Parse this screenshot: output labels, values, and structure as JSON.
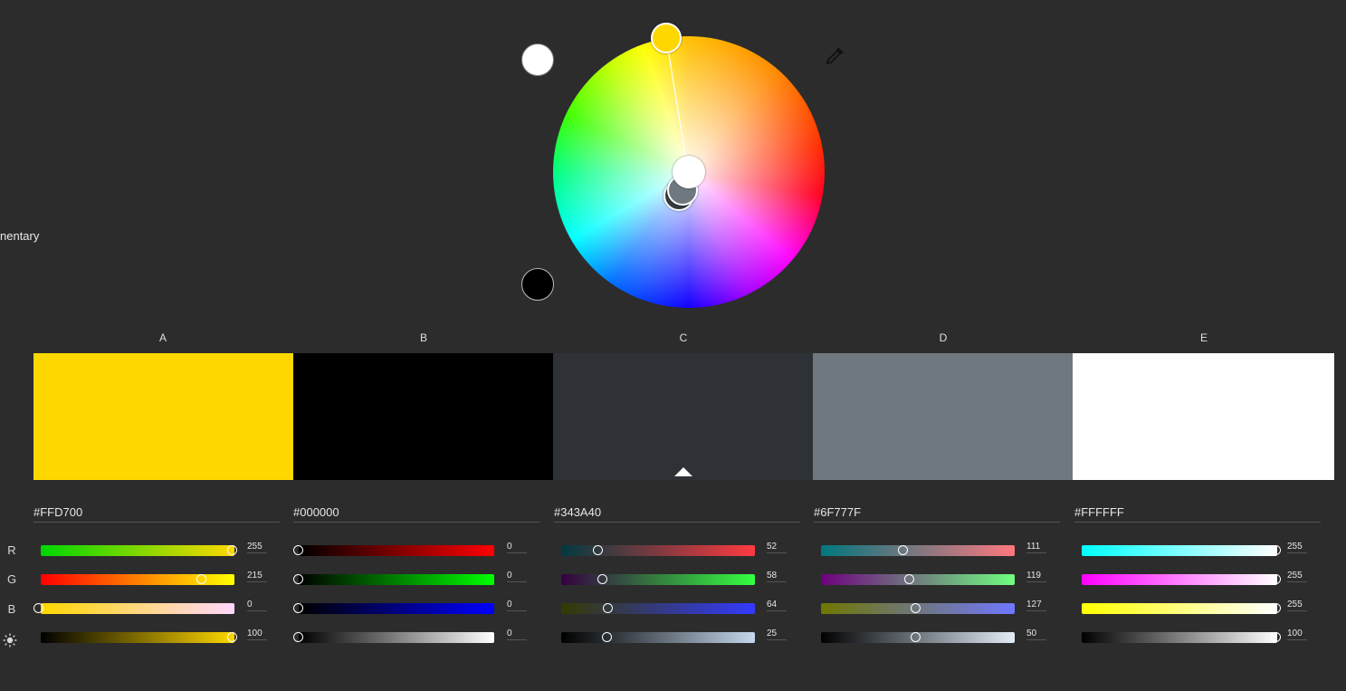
{
  "harmony_rule": {
    "label": "nentary"
  },
  "wheel": {
    "light_color": "#FFFFFF",
    "dark_color": "#000000",
    "eyedropper_icon": "eyedropper-icon"
  },
  "row_labels": [
    "R",
    "G",
    "B",
    "brightness-icon"
  ],
  "swatches": [
    {
      "letter": "A",
      "hex": "#FFD700",
      "color": "#FFD700",
      "r": "255",
      "g": "215",
      "b": "0",
      "brightness": "100"
    },
    {
      "letter": "B",
      "hex": "#000000",
      "color": "#000000",
      "r": "0",
      "g": "0",
      "b": "0",
      "brightness": "0"
    },
    {
      "letter": "C",
      "hex": "#343A40",
      "color": "#343A40",
      "r": "52",
      "g": "58",
      "b": "64",
      "brightness": "25",
      "active": true
    },
    {
      "letter": "D",
      "hex": "#6F777F",
      "color": "#6F777F",
      "r": "111",
      "g": "119",
      "b": "127",
      "brightness": "50"
    },
    {
      "letter": "E",
      "hex": "#FFFFFF",
      "color": "#FFFFFF",
      "r": "255",
      "g": "255",
      "b": "255",
      "brightness": "100"
    }
  ]
}
